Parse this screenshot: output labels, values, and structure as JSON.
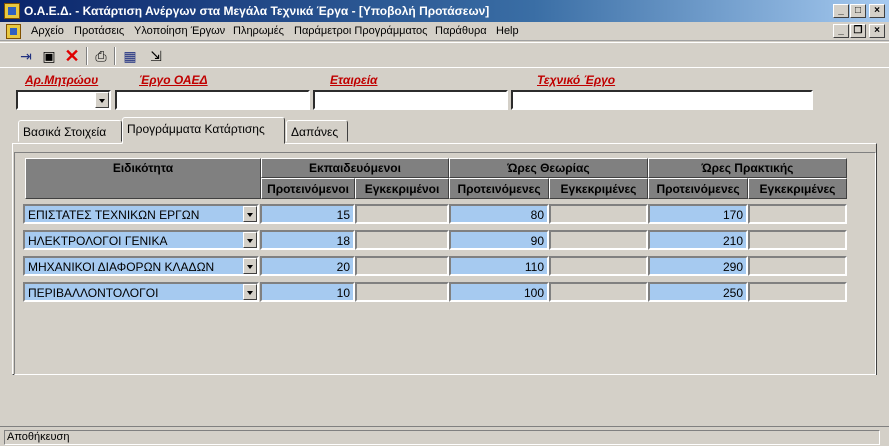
{
  "window": {
    "title": "Ο.Α.Ε.Δ. - Κατάρτιση Ανέργων στα Μεγάλα Τεχνικά Έργα - [Υποβολή Προτάσεων]"
  },
  "menu": [
    "Αρχείο",
    "Προτάσεις",
    "Υλοποίηση Έργων",
    "Πληρωμές",
    "Παράμετροι Προγράμματος",
    "Παράθυρα",
    "Help"
  ],
  "filters": {
    "protocol_label": "Αρ.Μητρώου",
    "project_label": "Έργο ΟΑΕΔ",
    "company_label": "Εταιρεία",
    "tech_project_label": "Τεχνικό Έργο",
    "protocol_value": "",
    "project_value": "",
    "company_value": "",
    "tech_project_value": ""
  },
  "tabs": [
    "Βασικά Στοιχεία",
    "Προγράμματα Κατάρτισης",
    "Δαπάνες"
  ],
  "table": {
    "headers": {
      "specialty": "Ειδικότητα",
      "trainees": "Εκπαιδευόμενοι",
      "theory_hours": "Ώρες Θεωρίας",
      "practice_hours": "Ώρες Πρακτικής",
      "proposed_m": "Προτεινόμενοι",
      "approved_m": "Εγκεκριμένοι",
      "proposed_f": "Προτεινόμενες",
      "approved_f": "Εγκεκριμένες"
    },
    "rows": [
      {
        "specialty": "ΕΠΙΣΤΑΤΕΣ ΤΕΧΝΙΚΩΝ ΕΡΓΩΝ",
        "trainees": "15",
        "theory": "80",
        "practice": "170"
      },
      {
        "specialty": "ΗΛΕΚΤΡΟΛΟΓΟΙ ΓΕΝΙΚΑ",
        "trainees": "18",
        "theory": "90",
        "practice": "210"
      },
      {
        "specialty": "ΜΗΧΑΝΙΚΟΙ ΔΙΑΦΟΡΩΝ ΚΛΑΔΩΝ",
        "trainees": "20",
        "theory": "110",
        "practice": "290"
      },
      {
        "specialty": "ΠΕΡΙΒΑΛΛΟΝΤΟΛΟΓΟΙ",
        "trainees": "10",
        "theory": "100",
        "practice": "250"
      }
    ]
  },
  "status": {
    "text": "Αποθήκευση"
  }
}
